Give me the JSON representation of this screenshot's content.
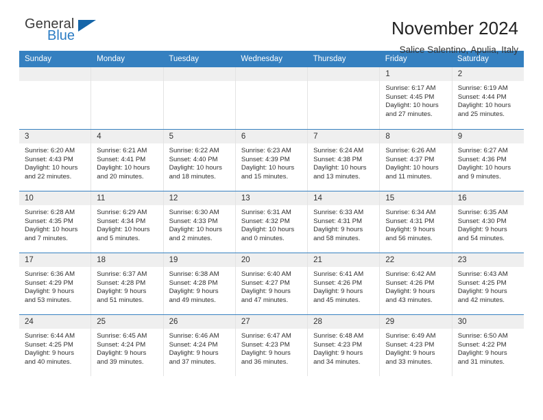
{
  "logo": {
    "word1": "General",
    "word2": "Blue",
    "triangle_color": "#1565a8",
    "blue": "#2b7cc4"
  },
  "header": {
    "title": "November 2024",
    "subtitle": "Salice Salentino, Apulia, Italy"
  },
  "theme": {
    "header_blue": "#3580c0",
    "daynum_band": "#efefef",
    "text": "#2e2e2e"
  },
  "weekdays": [
    "Sunday",
    "Monday",
    "Tuesday",
    "Wednesday",
    "Thursday",
    "Friday",
    "Saturday"
  ],
  "weeks": [
    [
      {
        "day": ""
      },
      {
        "day": ""
      },
      {
        "day": ""
      },
      {
        "day": ""
      },
      {
        "day": ""
      },
      {
        "day": "1",
        "sunrise": "Sunrise: 6:17 AM",
        "sunset": "Sunset: 4:45 PM",
        "daylight": "Daylight: 10 hours and 27 minutes."
      },
      {
        "day": "2",
        "sunrise": "Sunrise: 6:19 AM",
        "sunset": "Sunset: 4:44 PM",
        "daylight": "Daylight: 10 hours and 25 minutes."
      }
    ],
    [
      {
        "day": "3",
        "sunrise": "Sunrise: 6:20 AM",
        "sunset": "Sunset: 4:43 PM",
        "daylight": "Daylight: 10 hours and 22 minutes."
      },
      {
        "day": "4",
        "sunrise": "Sunrise: 6:21 AM",
        "sunset": "Sunset: 4:41 PM",
        "daylight": "Daylight: 10 hours and 20 minutes."
      },
      {
        "day": "5",
        "sunrise": "Sunrise: 6:22 AM",
        "sunset": "Sunset: 4:40 PM",
        "daylight": "Daylight: 10 hours and 18 minutes."
      },
      {
        "day": "6",
        "sunrise": "Sunrise: 6:23 AM",
        "sunset": "Sunset: 4:39 PM",
        "daylight": "Daylight: 10 hours and 15 minutes."
      },
      {
        "day": "7",
        "sunrise": "Sunrise: 6:24 AM",
        "sunset": "Sunset: 4:38 PM",
        "daylight": "Daylight: 10 hours and 13 minutes."
      },
      {
        "day": "8",
        "sunrise": "Sunrise: 6:26 AM",
        "sunset": "Sunset: 4:37 PM",
        "daylight": "Daylight: 10 hours and 11 minutes."
      },
      {
        "day": "9",
        "sunrise": "Sunrise: 6:27 AM",
        "sunset": "Sunset: 4:36 PM",
        "daylight": "Daylight: 10 hours and 9 minutes."
      }
    ],
    [
      {
        "day": "10",
        "sunrise": "Sunrise: 6:28 AM",
        "sunset": "Sunset: 4:35 PM",
        "daylight": "Daylight: 10 hours and 7 minutes."
      },
      {
        "day": "11",
        "sunrise": "Sunrise: 6:29 AM",
        "sunset": "Sunset: 4:34 PM",
        "daylight": "Daylight: 10 hours and 5 minutes."
      },
      {
        "day": "12",
        "sunrise": "Sunrise: 6:30 AM",
        "sunset": "Sunset: 4:33 PM",
        "daylight": "Daylight: 10 hours and 2 minutes."
      },
      {
        "day": "13",
        "sunrise": "Sunrise: 6:31 AM",
        "sunset": "Sunset: 4:32 PM",
        "daylight": "Daylight: 10 hours and 0 minutes."
      },
      {
        "day": "14",
        "sunrise": "Sunrise: 6:33 AM",
        "sunset": "Sunset: 4:31 PM",
        "daylight": "Daylight: 9 hours and 58 minutes."
      },
      {
        "day": "15",
        "sunrise": "Sunrise: 6:34 AM",
        "sunset": "Sunset: 4:31 PM",
        "daylight": "Daylight: 9 hours and 56 minutes."
      },
      {
        "day": "16",
        "sunrise": "Sunrise: 6:35 AM",
        "sunset": "Sunset: 4:30 PM",
        "daylight": "Daylight: 9 hours and 54 minutes."
      }
    ],
    [
      {
        "day": "17",
        "sunrise": "Sunrise: 6:36 AM",
        "sunset": "Sunset: 4:29 PM",
        "daylight": "Daylight: 9 hours and 53 minutes."
      },
      {
        "day": "18",
        "sunrise": "Sunrise: 6:37 AM",
        "sunset": "Sunset: 4:28 PM",
        "daylight": "Daylight: 9 hours and 51 minutes."
      },
      {
        "day": "19",
        "sunrise": "Sunrise: 6:38 AM",
        "sunset": "Sunset: 4:28 PM",
        "daylight": "Daylight: 9 hours and 49 minutes."
      },
      {
        "day": "20",
        "sunrise": "Sunrise: 6:40 AM",
        "sunset": "Sunset: 4:27 PM",
        "daylight": "Daylight: 9 hours and 47 minutes."
      },
      {
        "day": "21",
        "sunrise": "Sunrise: 6:41 AM",
        "sunset": "Sunset: 4:26 PM",
        "daylight": "Daylight: 9 hours and 45 minutes."
      },
      {
        "day": "22",
        "sunrise": "Sunrise: 6:42 AM",
        "sunset": "Sunset: 4:26 PM",
        "daylight": "Daylight: 9 hours and 43 minutes."
      },
      {
        "day": "23",
        "sunrise": "Sunrise: 6:43 AM",
        "sunset": "Sunset: 4:25 PM",
        "daylight": "Daylight: 9 hours and 42 minutes."
      }
    ],
    [
      {
        "day": "24",
        "sunrise": "Sunrise: 6:44 AM",
        "sunset": "Sunset: 4:25 PM",
        "daylight": "Daylight: 9 hours and 40 minutes."
      },
      {
        "day": "25",
        "sunrise": "Sunrise: 6:45 AM",
        "sunset": "Sunset: 4:24 PM",
        "daylight": "Daylight: 9 hours and 39 minutes."
      },
      {
        "day": "26",
        "sunrise": "Sunrise: 6:46 AM",
        "sunset": "Sunset: 4:24 PM",
        "daylight": "Daylight: 9 hours and 37 minutes."
      },
      {
        "day": "27",
        "sunrise": "Sunrise: 6:47 AM",
        "sunset": "Sunset: 4:23 PM",
        "daylight": "Daylight: 9 hours and 36 minutes."
      },
      {
        "day": "28",
        "sunrise": "Sunrise: 6:48 AM",
        "sunset": "Sunset: 4:23 PM",
        "daylight": "Daylight: 9 hours and 34 minutes."
      },
      {
        "day": "29",
        "sunrise": "Sunrise: 6:49 AM",
        "sunset": "Sunset: 4:23 PM",
        "daylight": "Daylight: 9 hours and 33 minutes."
      },
      {
        "day": "30",
        "sunrise": "Sunrise: 6:50 AM",
        "sunset": "Sunset: 4:22 PM",
        "daylight": "Daylight: 9 hours and 31 minutes."
      }
    ]
  ]
}
